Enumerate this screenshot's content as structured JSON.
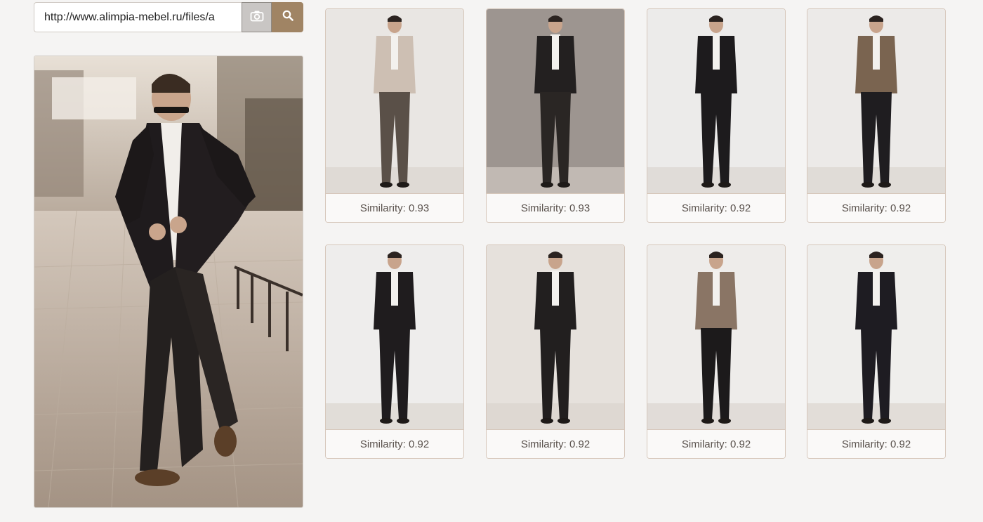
{
  "search": {
    "url_value": "http://www.alimpia-mebel.ru/files/a"
  },
  "icons": {
    "camera": "camera-icon",
    "search": "search-icon"
  },
  "colors": {
    "background": "#f5f4f3",
    "search_button": "#a08464",
    "camera_button": "#c9c6c4",
    "card_border": "#d6c7bb"
  },
  "query_image": {
    "subject": "man in dark suit walking on street"
  },
  "results": [
    {
      "caption": "Similarity: 0.93",
      "jacket": "#cdbfb3",
      "pants": "#5a5048",
      "bg": "#e9e6e3"
    },
    {
      "caption": "Similarity: 0.93",
      "jacket": "#232020",
      "pants": "#2a2624",
      "bg": "#9d9590"
    },
    {
      "caption": "Similarity: 0.92",
      "jacket": "#1d1b1d",
      "pants": "#1d1b1d",
      "bg": "#ecebea"
    },
    {
      "caption": "Similarity: 0.92",
      "jacket": "#7a6450",
      "pants": "#1f1d20",
      "bg": "#eceae8"
    },
    {
      "caption": "Similarity: 0.92",
      "jacket": "#1f1c1e",
      "pants": "#1f1c1e",
      "bg": "#eeedec"
    },
    {
      "caption": "Similarity: 0.92",
      "jacket": "#221f1f",
      "pants": "#221f1f",
      "bg": "#e6e1dc"
    },
    {
      "caption": "Similarity: 0.92",
      "jacket": "#8a7565",
      "pants": "#1c1a1b",
      "bg": "#eeecea"
    },
    {
      "caption": "Similarity: 0.92",
      "jacket": "#1e1c22",
      "pants": "#1e1c22",
      "bg": "#efeeec"
    }
  ]
}
